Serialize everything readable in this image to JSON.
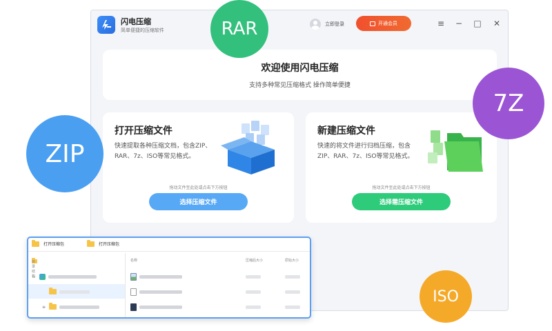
{
  "badges": {
    "rar": "RAR",
    "z7": "7Z",
    "zip": "ZIP",
    "iso": "ISO"
  },
  "window": {
    "app_name": "闪电压缩",
    "app_subtitle": "简单便捷的压缩软件",
    "login_label": "立即登录",
    "vip_label": "开通会员",
    "controls": {
      "menu": "≡",
      "minimize": "−",
      "maximize": "□",
      "close": "✕"
    }
  },
  "welcome": {
    "title": "欢迎使用闪电压缩",
    "subtitle": "支持多种常见压缩格式 操作简单便捷"
  },
  "open_card": {
    "title": "打开压缩文件",
    "description": "快速提取各种压缩文档，包含ZIP、RAR、7z、ISO等常见格式。",
    "drag_hint": "拖动文件至此处或点击下方按钮",
    "button_label": "选择压缩文件"
  },
  "create_card": {
    "title": "新建压缩文件",
    "description": "快速的将文件进行归档压缩，包含ZIP、RAR、7z、ISO等常见格式。",
    "drag_hint": "拖动文件至此处或点击下方按钮",
    "button_label": "选择需压缩文件"
  },
  "explorer": {
    "tabs": [
      "打开压缩包",
      "打开压缩包"
    ],
    "columns": {
      "tree": "目录结构",
      "name": "名称",
      "compressed_size": "压缩后大小",
      "original_size": "原始大小"
    }
  },
  "colors": {
    "accent_blue": "#58a9f5",
    "accent_green": "#2ecb7b",
    "vip_red": "#f0502e",
    "badge_rar": "#33c07d",
    "badge_7z": "#9b55d4",
    "badge_zip": "#4a9ff0",
    "badge_iso": "#f5a929"
  }
}
